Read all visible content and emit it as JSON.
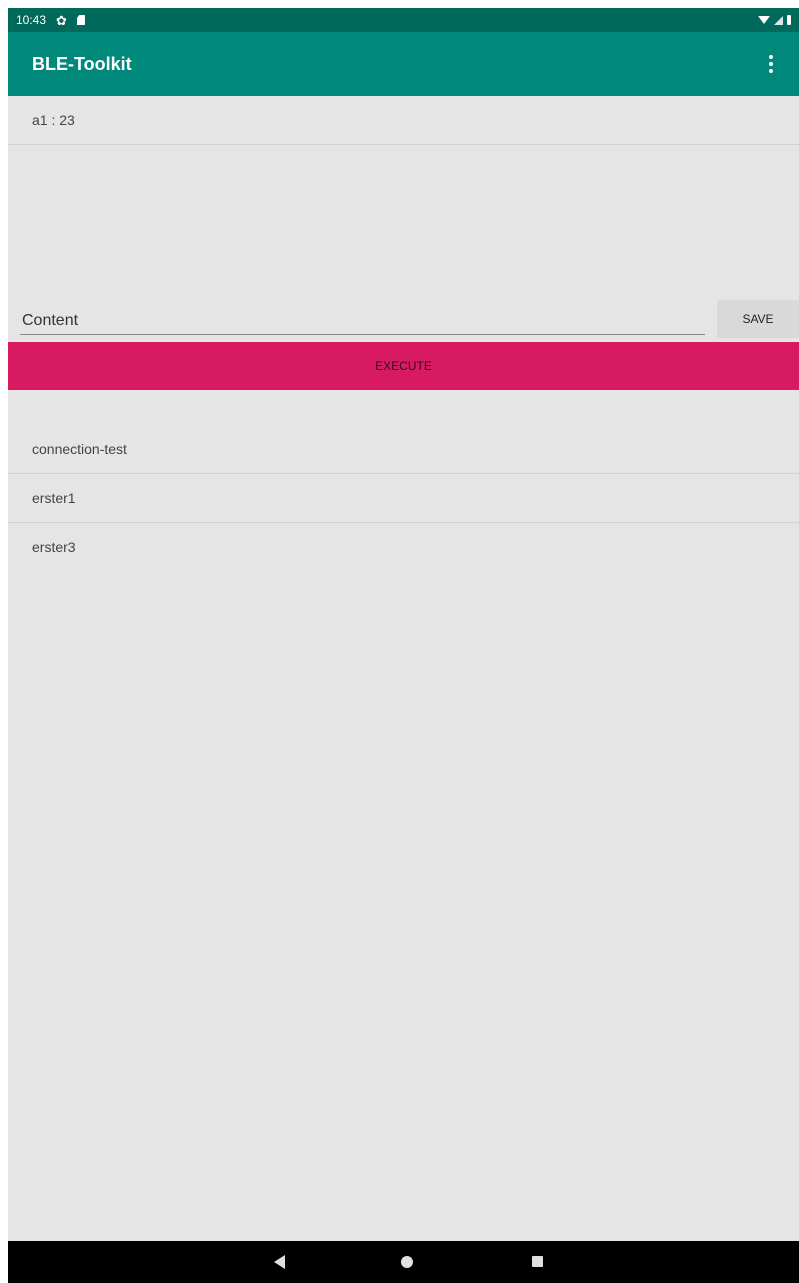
{
  "status_bar": {
    "time": "10:43",
    "icons": [
      "gear-icon",
      "sd-card-icon",
      "wifi-icon",
      "signal-icon",
      "battery-icon"
    ]
  },
  "app_bar": {
    "title": "BLE-Toolkit",
    "menu_icon": "overflow-menu-icon"
  },
  "device": {
    "label": "a1 : 23"
  },
  "editor": {
    "content_placeholder": "Content",
    "content_value": "",
    "save_label": "SAVE",
    "execute_label": "EXECUTE"
  },
  "scripts": {
    "items": [
      {
        "label": "connection-test"
      },
      {
        "label": "erster1"
      },
      {
        "label": "erster3"
      }
    ]
  },
  "nav_bar": {
    "icons": [
      "back-icon",
      "home-icon",
      "recents-icon"
    ]
  },
  "colors": {
    "status_bar": "#00695c",
    "app_bar": "#00897b",
    "accent": "#d81b60",
    "background": "#e5e5e5"
  }
}
